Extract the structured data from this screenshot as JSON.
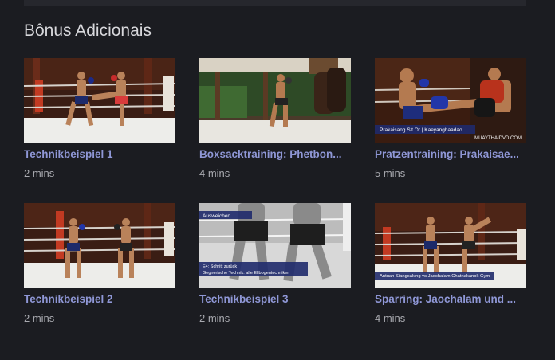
{
  "section": {
    "title": "Bônus Adicionais"
  },
  "videos": [
    {
      "title": "Technikbeispiel 1",
      "duration": "2 mins",
      "scene": "ring-kick"
    },
    {
      "title": "Boxsacktraining: Phetbon...",
      "duration": "4 mins",
      "scene": "heavy-bag"
    },
    {
      "title": "Pratzentraining: Prakaisae...",
      "duration": "5 mins",
      "scene": "pads",
      "caption": "Prakaisang Sit Or | Kaeyanghaadao",
      "watermark": "MUAYTHAIDVD.COM"
    },
    {
      "title": "Technikbeispiel 2",
      "duration": "2 mins",
      "scene": "ring-stance"
    },
    {
      "title": "Technikbeispiel 3",
      "duration": "2 mins",
      "scene": "bw-closeup",
      "top_label": "Ausweichen",
      "caption_lines": [
        "E4: Schritt zurück",
        "Gegnerische Technik: alle Ellbogentechniken"
      ]
    },
    {
      "title": "Sparring: Jaochalam und ...",
      "duration": "4 mins",
      "scene": "ring-sparring",
      "caption": "Antuan Siangsaking vs Jaochalam Chatnakanok Gym"
    }
  ],
  "colors": {
    "background": "#1b1c21",
    "title": "#d8d8dc",
    "link": "#8f97d6",
    "muted": "#a9aab0"
  }
}
